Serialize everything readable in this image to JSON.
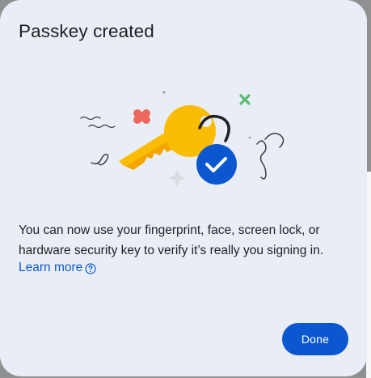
{
  "dialog": {
    "title": "Passkey created",
    "body_line_1": "You can now use your fingerprint, face, screen lock, or",
    "body_line_2": "hardware security key to verify it’s really you signing in.",
    "learn_more_label": "Learn more",
    "done_label": "Done"
  },
  "icons": {
    "illustration": "passkey-key-with-checkmark",
    "help": "help-circle-icon"
  },
  "colors": {
    "dialog_background": "#e9eef6",
    "primary": "#0b57d0",
    "key_yellow": "#fbbc04",
    "accent_red": "#ee675c",
    "accent_green": "#5bb974",
    "text": "#1f1f1f"
  }
}
